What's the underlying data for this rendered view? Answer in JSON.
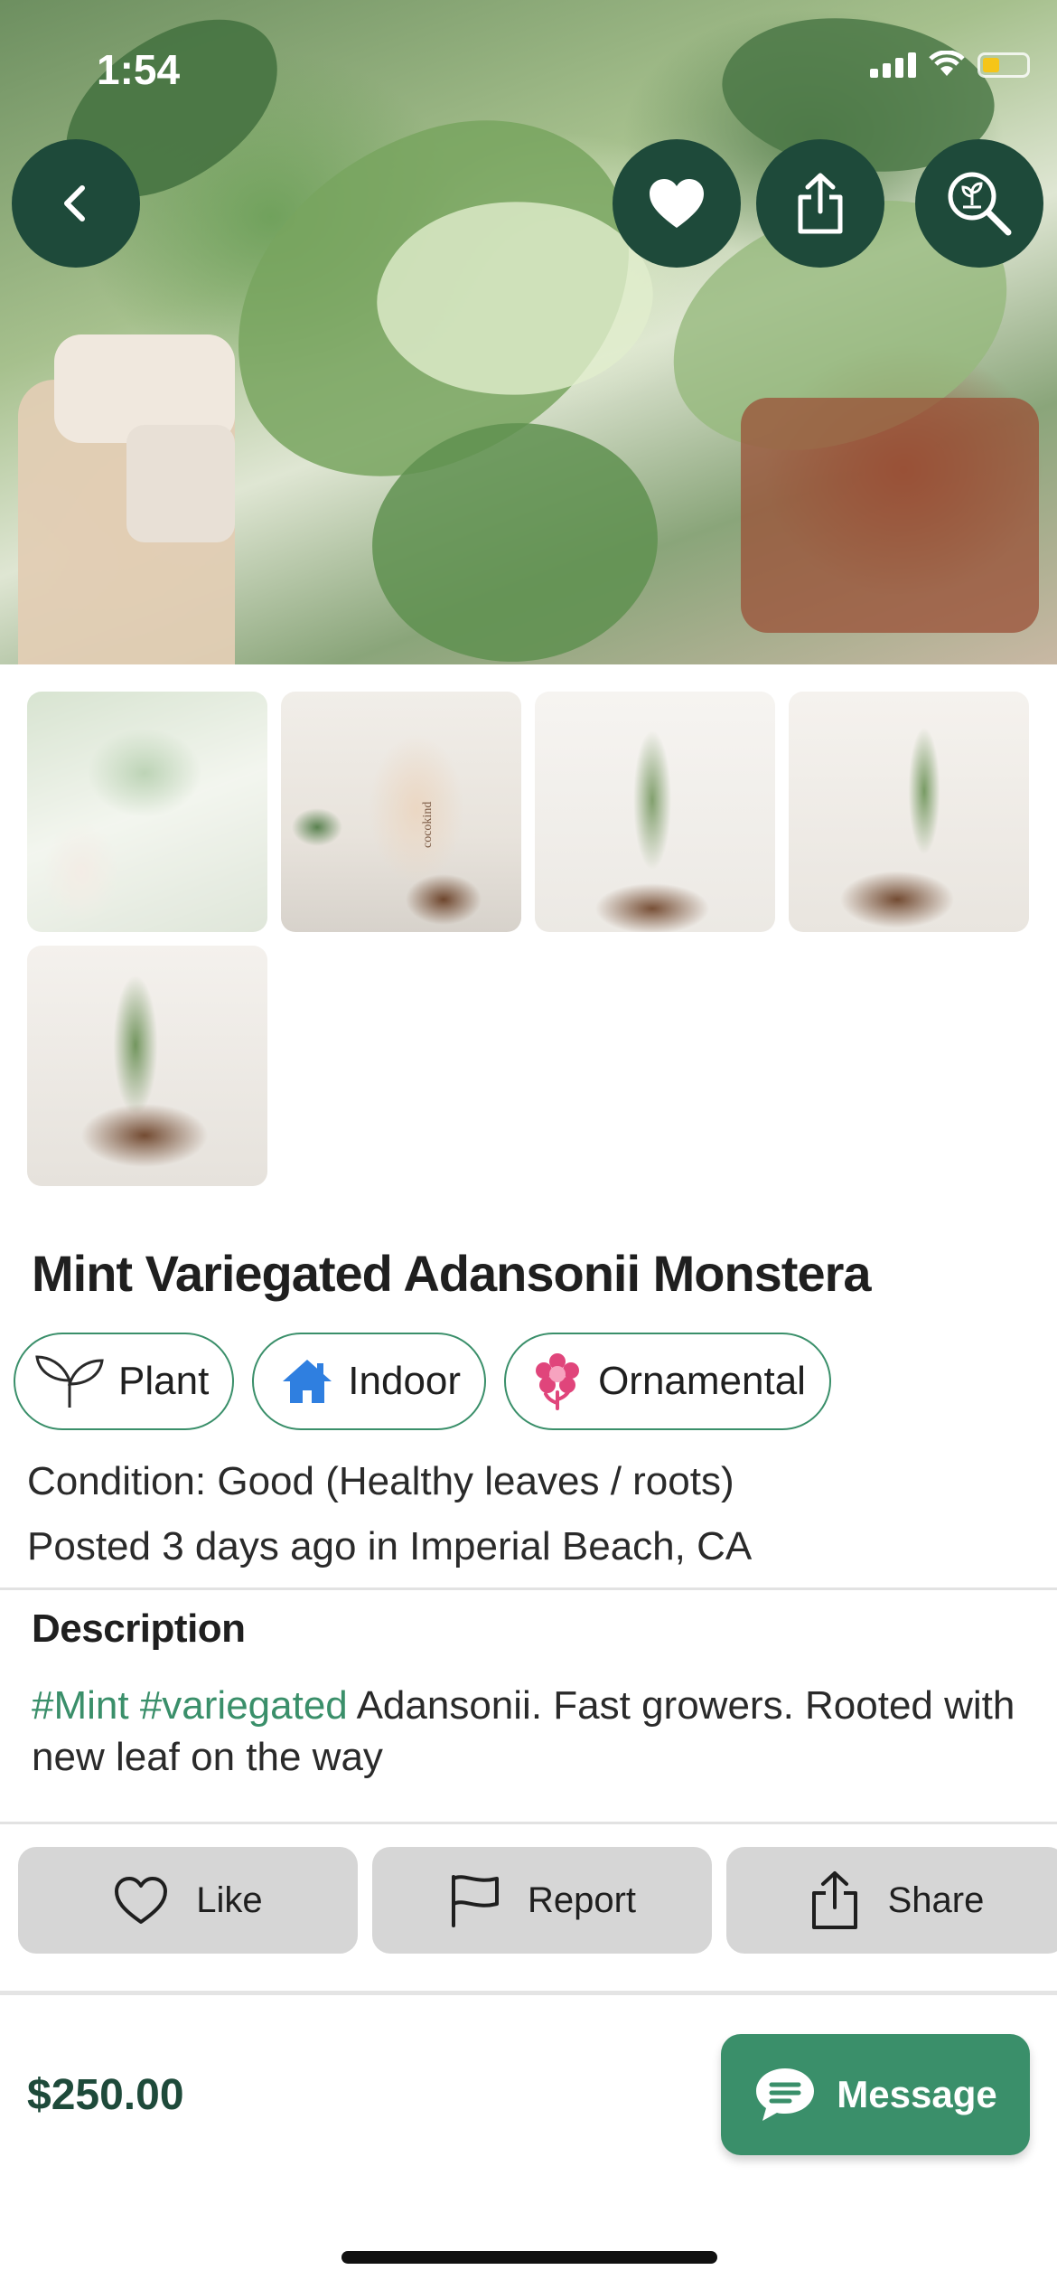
{
  "status_bar": {
    "time": "1:54"
  },
  "hero": {
    "back_icon": "chevron-left-icon",
    "favorite_icon": "heart-filled-icon",
    "share_icon": "share-icon",
    "identify_icon": "plant-search-icon"
  },
  "thumbnails": [
    {
      "name": "photo-1",
      "selected": true
    },
    {
      "name": "photo-2",
      "selected": false,
      "bottle_text": "cocokind"
    },
    {
      "name": "photo-3",
      "selected": false
    },
    {
      "name": "photo-4",
      "selected": false
    },
    {
      "name": "photo-5",
      "selected": false
    }
  ],
  "listing": {
    "title": "Mint Variegated Adansonii Monstera",
    "tags": [
      {
        "label": "Plant",
        "icon": "sprout-icon"
      },
      {
        "label": "Indoor",
        "icon": "house-icon"
      },
      {
        "label": "Ornamental",
        "icon": "flower-icon"
      }
    ],
    "condition": "Condition: Good (Healthy leaves / roots)",
    "posted": "Posted 3 days ago in Imperial Beach, CA"
  },
  "description": {
    "heading": "Description",
    "hashtag_1": "#Mint",
    "hashtag_2": "#variegated",
    "text": " Adansonii. Fast growers. Rooted with new leaf on the way"
  },
  "actions": {
    "like": "Like",
    "report": "Report",
    "share": "Share"
  },
  "footer": {
    "price": "$250.00",
    "message": "Message"
  },
  "colors": {
    "brand_dark": "#1e4a3a",
    "brand_green": "#3a8f6a",
    "indoor_blue": "#2f7fe0",
    "flower_pink": "#e0457b",
    "button_gray": "#d6d6d6"
  }
}
